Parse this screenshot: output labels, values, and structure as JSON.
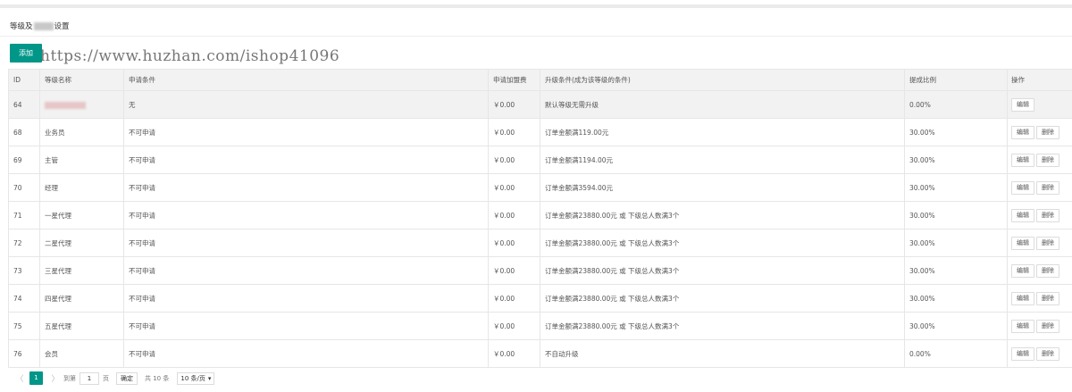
{
  "header": {
    "title_prefix": "等级及",
    "title_suffix": "设置"
  },
  "toolbar": {
    "add_label": "添加"
  },
  "watermark": "https://www.huzhan.com/ishop41096",
  "colors": {
    "primary": "#009688",
    "header_bg": "#f2f2f2",
    "border": "#e6e6e6"
  },
  "table": {
    "headers": [
      "ID",
      "等级名称",
      "申请条件",
      "申请加盟费",
      "升级条件(成为该等级的条件)",
      "提成比例",
      "操作"
    ],
    "rows": [
      {
        "id": "64",
        "name": "",
        "apply": "无",
        "fee": "￥0.00",
        "condition": "默认等级无需升级",
        "rate": "0.00%"
      },
      {
        "id": "68",
        "name": "业务员",
        "apply": "不可申请",
        "fee": "￥0.00",
        "condition": "订单金额满119.00元",
        "rate": "30.00%"
      },
      {
        "id": "69",
        "name": "主管",
        "apply": "不可申请",
        "fee": "￥0.00",
        "condition": "订单金额满1194.00元",
        "rate": "30.00%"
      },
      {
        "id": "70",
        "name": "经理",
        "apply": "不可申请",
        "fee": "￥0.00",
        "condition": "订单金额满3594.00元",
        "rate": "30.00%"
      },
      {
        "id": "71",
        "name": "一星代理",
        "apply": "不可申请",
        "fee": "￥0.00",
        "condition": "订单金额满23880.00元 或 下级总人数满3个",
        "rate": "30.00%"
      },
      {
        "id": "72",
        "name": "二星代理",
        "apply": "不可申请",
        "fee": "￥0.00",
        "condition": "订单金额满23880.00元 或 下级总人数满3个",
        "rate": "30.00%"
      },
      {
        "id": "73",
        "name": "三星代理",
        "apply": "不可申请",
        "fee": "￥0.00",
        "condition": "订单金额满23880.00元 或 下级总人数满3个",
        "rate": "30.00%"
      },
      {
        "id": "74",
        "name": "四星代理",
        "apply": "不可申请",
        "fee": "￥0.00",
        "condition": "订单金额满23880.00元 或 下级总人数满3个",
        "rate": "30.00%"
      },
      {
        "id": "75",
        "name": "五星代理",
        "apply": "不可申请",
        "fee": "￥0.00",
        "condition": "订单金额满23880.00元 或 下级总人数满3个",
        "rate": "30.00%"
      },
      {
        "id": "76",
        "name": "会员",
        "apply": "不可申请",
        "fee": "￥0.00",
        "condition": "不自动升级",
        "rate": "0.00%"
      }
    ],
    "edit_label": "编辑",
    "delete_label": "删除"
  },
  "pagination": {
    "prev": "〈",
    "next": "〉",
    "current_page": "1",
    "goto_label": "到第",
    "page_input_value": "1",
    "page_unit": "页",
    "confirm_label": "确定",
    "total_label": "共 10 条",
    "page_size_selected": "10 条/页"
  }
}
